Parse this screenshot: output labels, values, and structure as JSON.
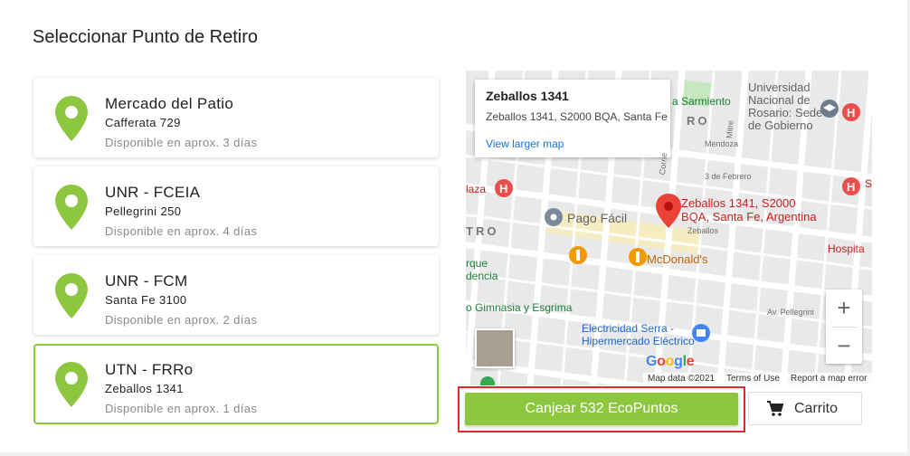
{
  "page": {
    "title": "Seleccionar Punto de Retiro"
  },
  "locations": [
    {
      "name": "Mercado del Patio",
      "address": "Cafferata 729",
      "eta": "Disponible en aprox. 3 días",
      "selected": false
    },
    {
      "name": "UNR - FCEIA",
      "address": "Pellegrini 250",
      "eta": "Disponible en aprox. 4 días",
      "selected": false
    },
    {
      "name": "UNR - FCM",
      "address": "Santa Fe 3100",
      "eta": "Disponible en aprox. 2 días",
      "selected": false
    },
    {
      "name": "UTN - FRRo",
      "address": "Zeballos 1341",
      "eta": "Disponible en aprox. 1 días",
      "selected": true
    }
  ],
  "map": {
    "infowindow": {
      "title": "Zeballos 1341",
      "address": "Zeballos 1341, S2000 BQA, Santa Fe",
      "link": "View larger map"
    },
    "marker_label": [
      "Zeballos 1341, S2000",
      "BQA, Santa Fe, Argentina"
    ],
    "pois": {
      "pago_facil": "Pago Fácil",
      "mcdonalds": "McDonald's",
      "gimnasia": "o Gimnasia y Esgrima",
      "electricidad": [
        "Electricidad Serra -",
        "Hipermercado Eléctrico"
      ],
      "universidad": [
        "Universidad",
        "Nacional de",
        "Rosario: Sede",
        "de Gobierno"
      ],
      "sarmiento": "a Sarmiento",
      "hospital": "Hospita",
      "tro": "TRO",
      "ro": "RO",
      "laza": "laza",
      "rque": [
        "rque",
        "dencia"
      ],
      "s_frag": "S",
      "mendoza": "Mendoza",
      "tres_febrero": "3 de Febrero",
      "zeballos": "Zeballos",
      "pellegrini": "Av. Pellegrini",
      "corrientes": "Corrie",
      "mitre": "Mitre"
    },
    "google": "Google",
    "attribution": {
      "data": "Map data ©2021",
      "terms": "Terms of Use",
      "report": "Report a map error"
    },
    "zoom_in": "+",
    "zoom_out": "−"
  },
  "actions": {
    "redeem": "Canjear 532 EcoPuntos",
    "cart": "Carrito"
  },
  "colors": {
    "accent": "#8dc63f",
    "highlight": "#e02b2b",
    "marker": "#ea4335",
    "link": "#1a73e8"
  },
  "icons": {
    "location_pin": "location-pin-icon",
    "cart": "cart-icon",
    "map_marker": "map-marker-icon"
  }
}
